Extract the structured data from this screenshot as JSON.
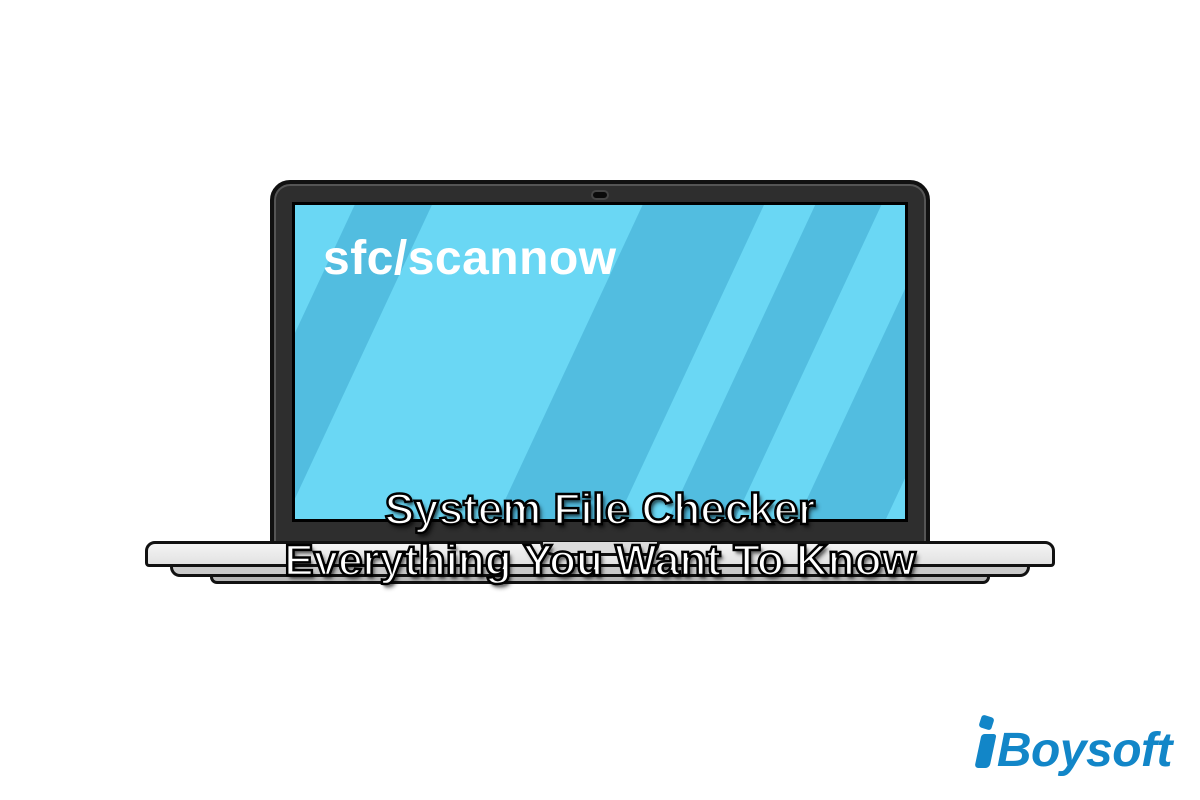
{
  "screen": {
    "command": "sfc/scannow"
  },
  "title": {
    "line1": "System File Checker",
    "line2": "Everything You Want To Know"
  },
  "brand": {
    "name": "Boysoft"
  },
  "colors": {
    "screen_bg": "#6ad7f4",
    "reflection": "#4db9dc",
    "brand": "#1286c8"
  }
}
